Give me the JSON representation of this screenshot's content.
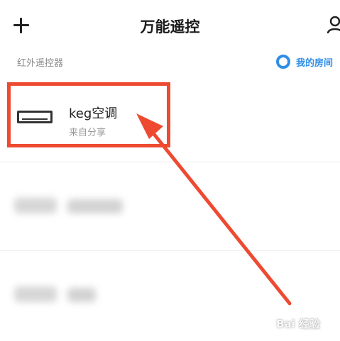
{
  "header": {
    "title": "万能遥控",
    "add_icon": "plus-icon",
    "user_icon": "user-icon"
  },
  "subheader": {
    "section_label": "红外遥控器",
    "room_link": "我的房间",
    "room_icon": "ring-icon"
  },
  "devices": [
    {
      "name": "keg空调",
      "subtitle": "来自分享",
      "icon": "air-conditioner-icon"
    },
    {
      "name": "",
      "subtitle": "",
      "icon": "air-conditioner-icon"
    },
    {
      "name": "",
      "subtitle": "",
      "icon": "air-conditioner-icon"
    }
  ],
  "annotation": {
    "highlight_color": "#ee4a32",
    "arrow_color": "#ee4a32"
  },
  "watermark": "Bai 经验",
  "colors": {
    "accent": "#2f8ee8",
    "text": "#1a1a1a",
    "secondary_text": "#8a8a8a"
  }
}
